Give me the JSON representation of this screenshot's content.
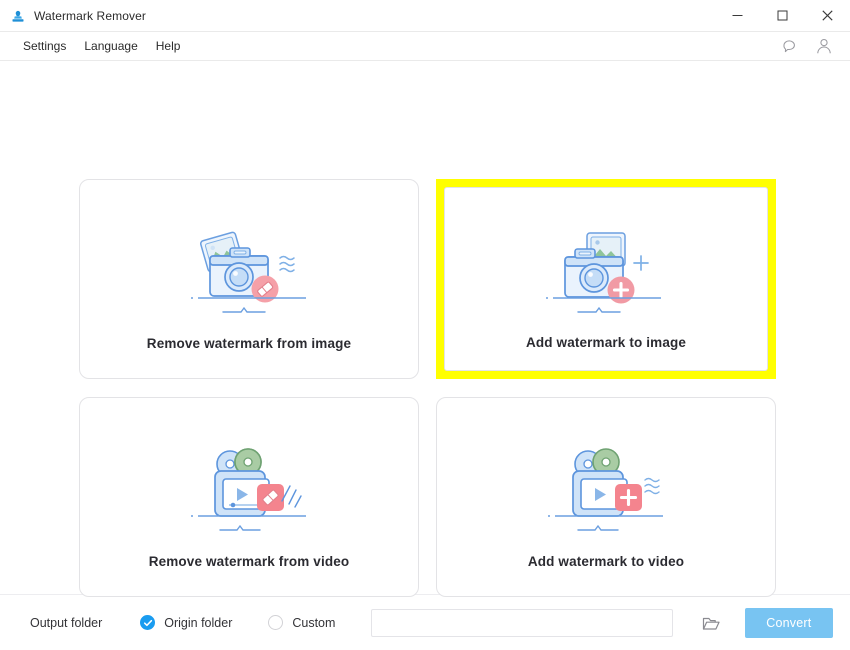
{
  "window": {
    "title": "Watermark Remover",
    "app_icon": "stamp-icon",
    "controls": {
      "minimize": "minimize-icon",
      "maximize": "maximize-icon",
      "close": "close-icon"
    }
  },
  "menubar": {
    "items": [
      {
        "label": "Settings"
      },
      {
        "label": "Language"
      },
      {
        "label": "Help"
      }
    ],
    "right_icons": [
      {
        "name": "feedback-bubble-icon"
      },
      {
        "name": "account-person-icon"
      }
    ]
  },
  "cards": [
    {
      "id": "remove-watermark-from-image",
      "label": "Remove watermark from image",
      "art": "camera-photos-eraser-icon",
      "highlighted": false
    },
    {
      "id": "add-watermark-to-image",
      "label": "Add watermark to image",
      "art": "camera-photos-plus-icon",
      "highlighted": true
    },
    {
      "id": "remove-watermark-from-video",
      "label": "Remove watermark from video",
      "art": "video-reel-eraser-icon",
      "highlighted": false
    },
    {
      "id": "add-watermark-to-video",
      "label": "Add watermark to video",
      "art": "video-reel-plus-icon",
      "highlighted": false
    }
  ],
  "bottombar": {
    "output_folder_label": "Output folder",
    "options": [
      {
        "label": "Origin folder",
        "selected": true
      },
      {
        "label": "Custom",
        "selected": false
      }
    ],
    "path_value": "",
    "path_placeholder": "",
    "browse_icon": "folder-open-icon",
    "convert_label": "Convert"
  },
  "colors": {
    "highlight": "#ffff00",
    "accent_blue": "#1a9cf0",
    "convert_button": "#78c4f2",
    "text": "#333337",
    "card_border": "#e3e3e6"
  }
}
